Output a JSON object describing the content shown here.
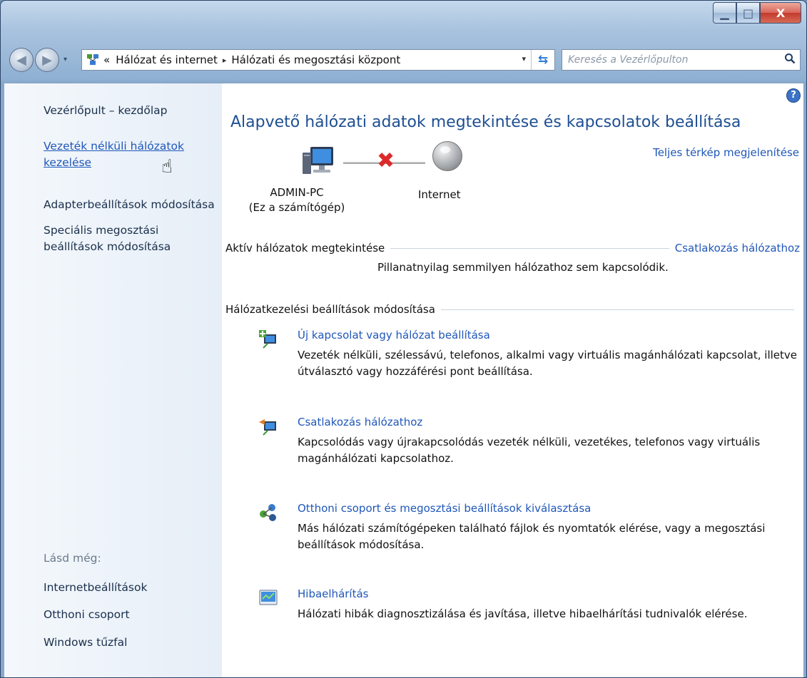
{
  "titlebar": {
    "minimize_glyph": "▁",
    "maximize_glyph": "□",
    "close_glyph": "X"
  },
  "nav": {
    "back_glyph": "◀",
    "forward_glyph": "▶",
    "dropdown_glyph": "▾",
    "address": {
      "overflow": "«",
      "crumb1": "Hálózat és internet",
      "separator": "▸",
      "crumb2": "Hálózati és megosztási központ",
      "dropdown_glyph": "▾",
      "refresh_glyph": "⇆"
    },
    "search": {
      "placeholder": "Keresés a Vezérlőpulton",
      "icon": "⌕"
    }
  },
  "sidebar": {
    "home": "Vezérlőpult – kezdőlap",
    "wireless_line1": "Vezeték nélküli hálózatok",
    "wireless_line2": "kezelése",
    "adapter": "Adapterbeállítások módosítása",
    "special_line1": "Speciális megosztási",
    "special_line2": "beállítások módosítása",
    "see_also": "Lásd még:",
    "internet_options": "Internetbeállítások",
    "homegroup": "Otthoni csoport",
    "firewall": "Windows tűzfal"
  },
  "main": {
    "help_glyph": "?",
    "title": "Alapvető hálózati adatok megtekintése és kapcsolatok beállítása",
    "full_map_link": "Teljes térkép megjelenítése",
    "pc_name": "ADMIN-PC",
    "pc_subtitle": "(Ez a számítógép)",
    "internet_label": "Internet",
    "x_glyph": "✖",
    "active_networks_heading": "Aktív hálózatok megtekintése",
    "connect_link": "Csatlakozás hálózathoz",
    "not_connected_text": "Pillanatnyilag semmilyen hálózathoz sem kapcsolódik.",
    "settings_heading": "Hálózatkezelési beállítások módosítása",
    "tasks": [
      {
        "icon": "new-connection-icon",
        "title": "Új kapcsolat vagy hálózat beállítása",
        "desc": "Vezeték nélküli, szélessávú, telefonos, alkalmi vagy virtuális magánhálózati kapcsolat, illetve útválasztó vagy hozzáférési pont beállítása."
      },
      {
        "icon": "connect-network-icon",
        "title": "Csatlakozás hálózathoz",
        "desc": "Kapcsolódás vagy újrakapcsolódás vezeték nélküli, vezetékes, telefonos vagy virtuális magánhálózati kapcsolathoz."
      },
      {
        "icon": "homegroup-icon",
        "title": "Otthoni csoport és megosztási beállítások kiválasztása",
        "desc": "Más hálózati számítógépeken található fájlok és nyomtatók elérése, vagy a megosztási beállítások módosítása."
      },
      {
        "icon": "troubleshoot-icon",
        "title": "Hibaelhárítás",
        "desc": "Hálózati hibák diagnosztizálása és javítása, illetve hibaelhárítási tudnivalók elérése."
      }
    ]
  },
  "colors": {
    "link": "#1f57b8",
    "title": "#1e4f92",
    "error_x": "#dc2a2a"
  }
}
